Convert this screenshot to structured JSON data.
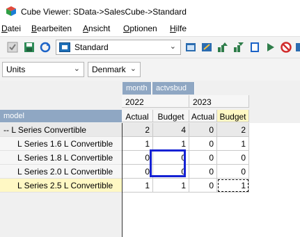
{
  "window": {
    "title": "Cube Viewer: SData->SalesCube->Standard",
    "app_icon": "cube-icon"
  },
  "menu": [
    {
      "label": "Datei",
      "key": "D"
    },
    {
      "label": "Bearbeiten",
      "key": "B"
    },
    {
      "label": "Ansicht",
      "key": "A"
    },
    {
      "label": "Optionen",
      "key": "O"
    },
    {
      "label": "Hilfe",
      "key": "H"
    }
  ],
  "toolbar": {
    "view_name": "Standard",
    "left_icons": [
      "checkbox-icon",
      "save-icon",
      "recalculate-icon"
    ],
    "right_icons": [
      "slice-to-excel-icon",
      "export-icon",
      "expand-all-icon",
      "collapse-icon",
      "edit-icon",
      "next-icon",
      "stop-icon",
      "filter-icon"
    ]
  },
  "filters": [
    {
      "name": "units-filter",
      "value": "Units"
    },
    {
      "name": "country-filter",
      "value": "Denmark"
    }
  ],
  "grid": {
    "column_dimensions": [
      "month",
      "actvsbud"
    ],
    "row_dimension": "model",
    "years": [
      "2022",
      "2023"
    ],
    "columns": [
      "Actual",
      "Budget",
      "Actual",
      "Budget"
    ],
    "rows": [
      {
        "label": "-- L Series Convertible",
        "values": [
          "2",
          "4",
          "0",
          "2"
        ]
      },
      {
        "label": "L Series 1.6 L Convertible",
        "values": [
          "1",
          "1",
          "0",
          "1"
        ]
      },
      {
        "label": "L Series 1.8 L Convertible",
        "values": [
          "0",
          "0",
          "0",
          "0"
        ]
      },
      {
        "label": "L Series 2.0 L Convertible",
        "values": [
          "0",
          "0",
          "0",
          "0"
        ]
      },
      {
        "label": "L Series 2.5 L Convertible",
        "values": [
          "1",
          "1",
          "0",
          "1"
        ]
      }
    ]
  },
  "colors": {
    "dim_tab": "#8fa7c3",
    "selection": "#fff8c4",
    "highlight": "#1421d4"
  }
}
